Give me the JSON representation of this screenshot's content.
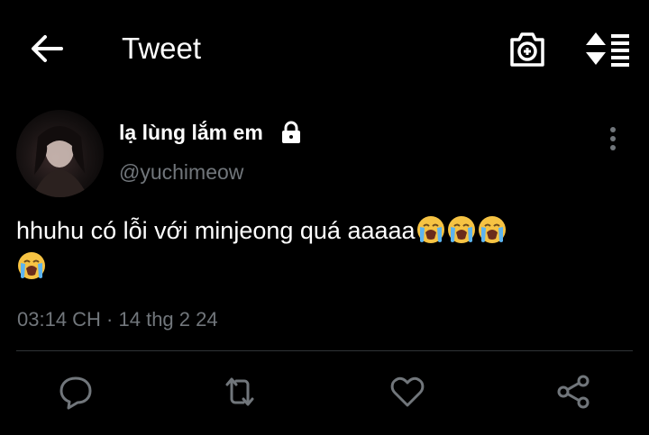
{
  "header": {
    "title": "Tweet",
    "back_icon": "back-arrow-icon",
    "camera_icon": "add-photo-icon",
    "sort_icon": "sort-icon"
  },
  "tweet": {
    "author_name": "lạ lùng lắm em",
    "handle": "@yuchimeow",
    "protected_icon": "lock-icon",
    "text": "hhuhu có lỗi với minjeong quá aaaaa",
    "emoji": [
      "loudly-crying-face",
      "loudly-crying-face",
      "loudly-crying-face",
      "loudly-crying-face"
    ],
    "timestamp": "03:14 CH · 14 thg 2 24"
  },
  "actions": {
    "reply_icon": "reply-icon",
    "retweet_icon": "retweet-icon",
    "like_icon": "heart-icon",
    "share_icon": "share-icon"
  },
  "colors": {
    "background": "#000000",
    "primary_text": "#ffffff",
    "secondary_text": "#71767b",
    "divider": "#2f3336"
  }
}
